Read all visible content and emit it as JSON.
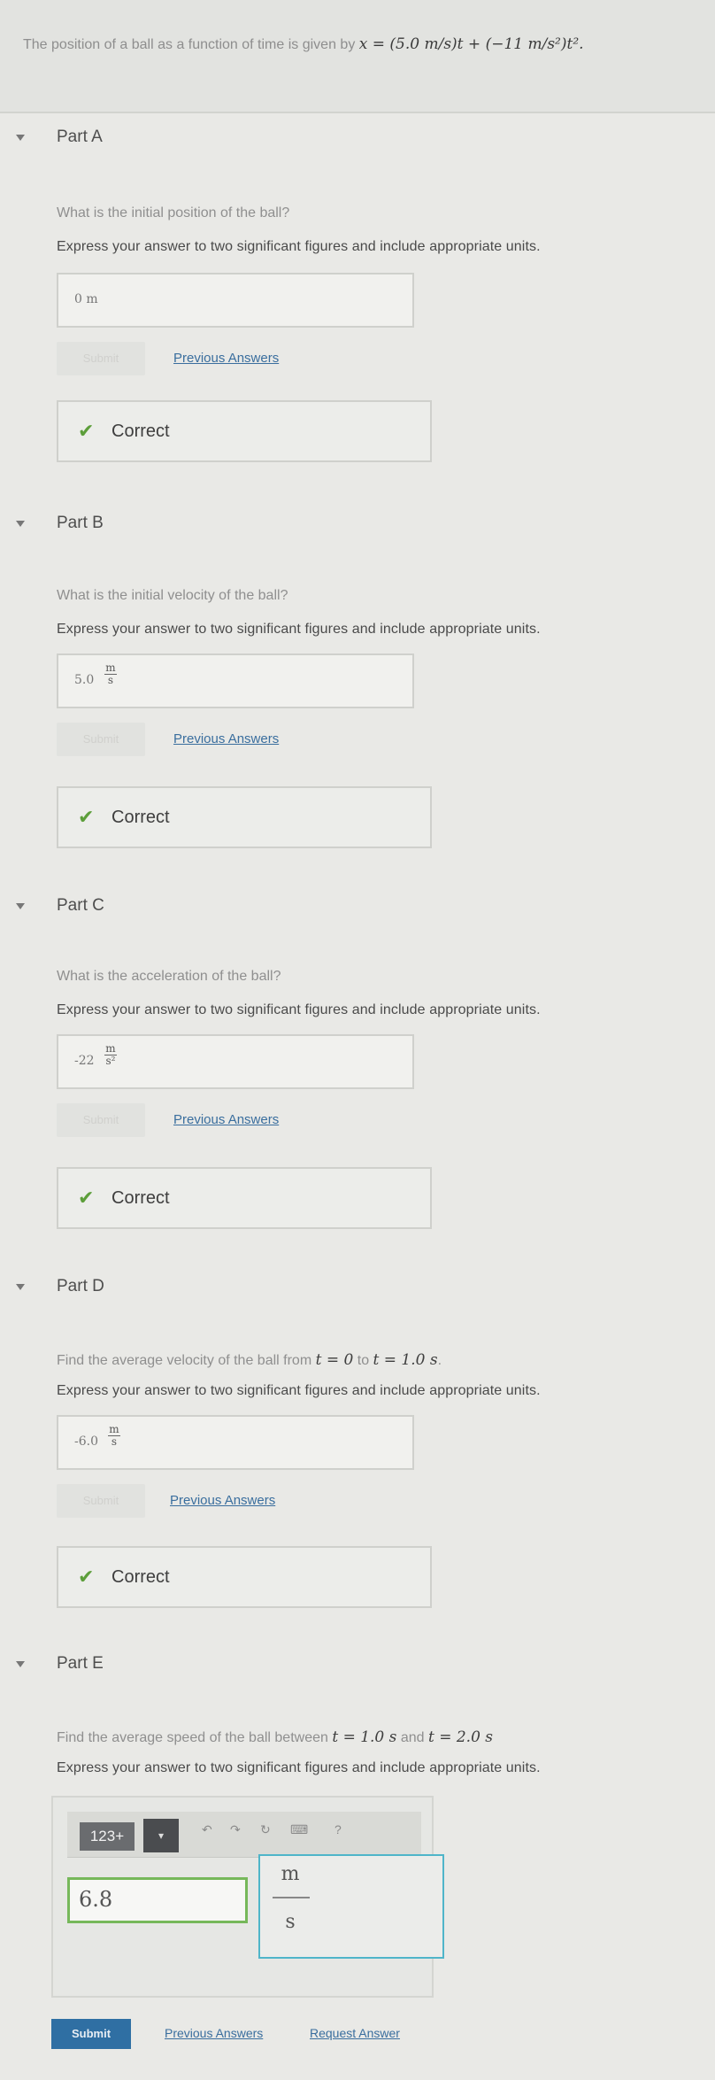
{
  "problem": {
    "text": "The position of a ball as a function of time is given by ",
    "equation": "x = (5.0 m/s)t + (−11 m/s²)t²."
  },
  "parts": [
    {
      "title": "Part A",
      "question": "What is the initial position of the ball?",
      "instruction": "Express your answer to two significant figures and include appropriate units.",
      "answer_value": "0",
      "answer_unit": "m",
      "submit_label": "Submit",
      "previous_answers_label": "Previous Answers",
      "feedback": "Correct"
    },
    {
      "title": "Part B",
      "question": "What is the initial velocity of the ball?",
      "instruction": "Express your answer to two significant figures and include appropriate units.",
      "answer_value": "5.0",
      "unit_num": "m",
      "unit_den": "s",
      "submit_label": "Submit",
      "previous_answers_label": "Previous Answers",
      "feedback": "Correct"
    },
    {
      "title": "Part C",
      "question": "What is the acceleration of the ball?",
      "instruction": "Express your answer to two significant figures and include appropriate units.",
      "answer_value": "-22",
      "unit_num": "m",
      "unit_den": "s²",
      "submit_label": "Submit",
      "previous_answers_label": "Previous Answers",
      "feedback": "Correct"
    },
    {
      "title": "Part D",
      "question_prefix": "Find the average velocity of the ball from ",
      "question_math_1": "t = 0",
      "question_mid": " to ",
      "question_math_2": "t = 1.0 s",
      "question_suffix": ".",
      "instruction": "Express your answer to two significant figures and include appropriate units.",
      "answer_value": "-6.0",
      "unit_num": "m",
      "unit_den": "s",
      "submit_label": "Submit",
      "previous_answers_label": "Previous Answers",
      "feedback": "Correct"
    },
    {
      "title": "Part E",
      "question_prefix": "Find the average speed of the ball between ",
      "question_math_1": "t = 1.0 s",
      "question_mid": " and ",
      "question_math_2": "t = 2.0 s",
      "question_suffix": "",
      "instruction": "Express your answer to two significant figures and include appropriate units.",
      "toolbar_123": "123+",
      "toolbar_question": "?",
      "input_value": "6.8",
      "unit_num": "m",
      "unit_den": "s",
      "submit_label": "Submit",
      "previous_answers_label": "Previous Answers",
      "request_answer_label": "Request Answer"
    }
  ],
  "colors": {
    "correct_check": "#5c9e3a",
    "link": "#3a6e9e",
    "submit_active": "#2f6fa3",
    "input_focus_border": "#76b85a",
    "units_border": "#4fb5c9"
  }
}
